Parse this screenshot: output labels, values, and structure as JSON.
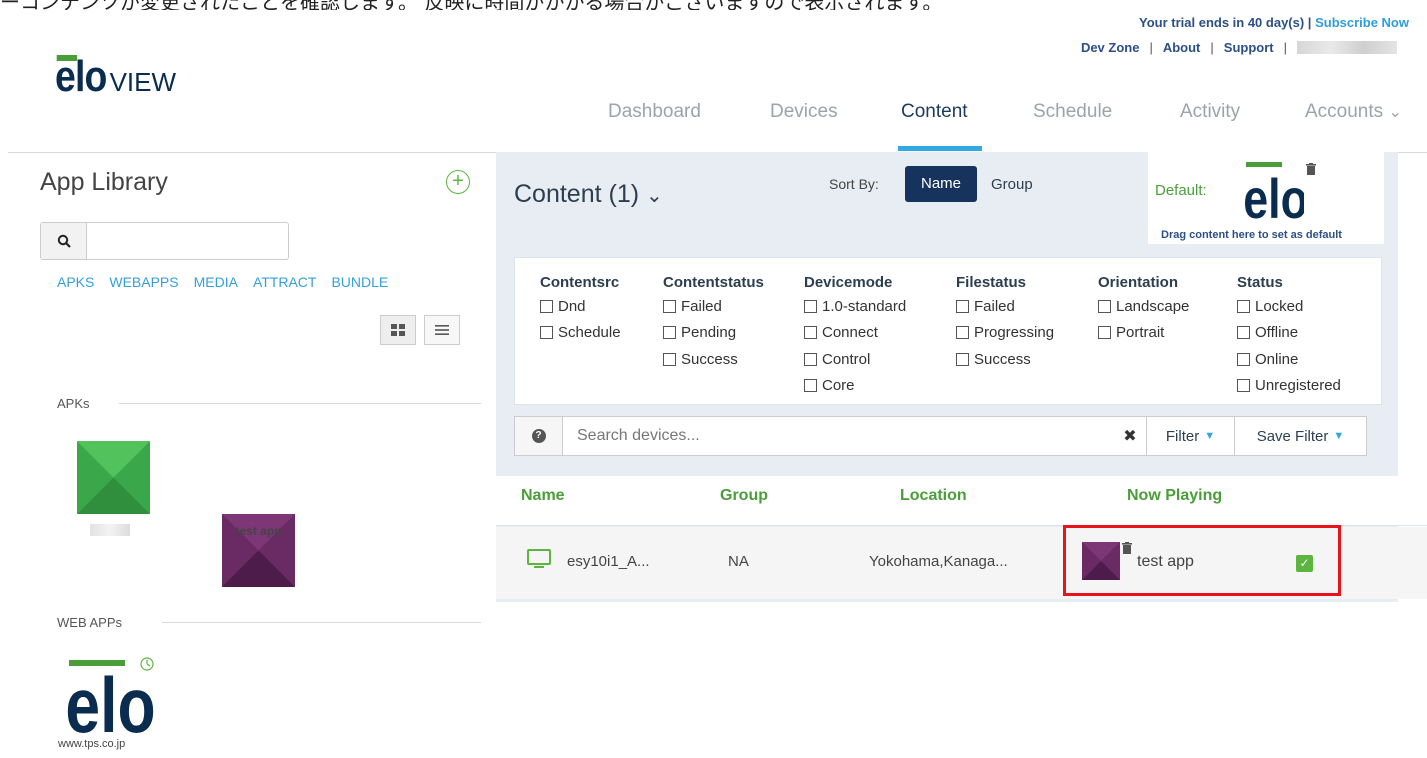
{
  "caption": "ーコンテンツが変更されたことを確認します。 反映に時間がかかる場合がございますので表示されます。",
  "header": {
    "trial_text": "Your trial ends in 40 day(s) |",
    "subscribe_label": "Subscribe Now",
    "dev_zone": "Dev Zone",
    "about": "About",
    "support": "Support",
    "sep": "|",
    "logo_view": "VIEW",
    "logo_elo": "elo"
  },
  "nav": {
    "items": [
      "Dashboard",
      "Devices",
      "Content",
      "Schedule",
      "Activity",
      "Accounts"
    ],
    "active": "Content",
    "accounts_caret": "⌄"
  },
  "library": {
    "title": "App Library",
    "add_icon": "+",
    "search_placeholder": "",
    "tabs": [
      "APKS",
      "WEBAPPS",
      "MEDIA",
      "ATTRACT",
      "BUNDLE"
    ],
    "sections": {
      "apks": "APKs",
      "webapps": "WEB APPs"
    },
    "apks": [
      {
        "label": "",
        "color": "#3aa84a"
      },
      {
        "label": "test app",
        "color": "#6a2a63"
      }
    ],
    "webapps": [
      {
        "label": "www.tps.co.jp"
      }
    ]
  },
  "content": {
    "title": "Content (1)",
    "title_caret": "⌄",
    "sort_label": "Sort By:",
    "sort_name": "Name",
    "sort_group": "Group",
    "default_label": "Default:",
    "default_hint": "Drag content here to set as default"
  },
  "filters": [
    {
      "head": "Contentsrc",
      "options": [
        "Dnd",
        "Schedule"
      ]
    },
    {
      "head": "Contentstatus",
      "options": [
        "Failed",
        "Pending",
        "Success"
      ]
    },
    {
      "head": "Devicemode",
      "options": [
        "1.0-standard",
        "Connect",
        "Control",
        "Core"
      ]
    },
    {
      "head": "Filestatus",
      "options": [
        "Failed",
        "Progressing",
        "Success"
      ]
    },
    {
      "head": "Orientation",
      "options": [
        "Landscape",
        "Portrait"
      ]
    },
    {
      "head": "Status",
      "options": [
        "Locked",
        "Offline",
        "Online",
        "Unregistered"
      ]
    }
  ],
  "device_search": {
    "placeholder": "Search devices...",
    "help_icon": "?",
    "clear_icon": "✖",
    "filter_label": "Filter",
    "save_filter_label": "Save Filter",
    "caret": "▼"
  },
  "table": {
    "columns": [
      "Name",
      "Group",
      "Location",
      "Now Playing"
    ],
    "rows": [
      {
        "name": "esy10i1_A...",
        "group": "NA",
        "location": "Yokohama,Kanaga...",
        "now_playing": "test app",
        "checked": true
      }
    ]
  },
  "colors": {
    "accent_blue": "#32a8e2",
    "navy": "#15335c",
    "green": "#4a9e3a",
    "highlight_red": "#e8141c"
  }
}
